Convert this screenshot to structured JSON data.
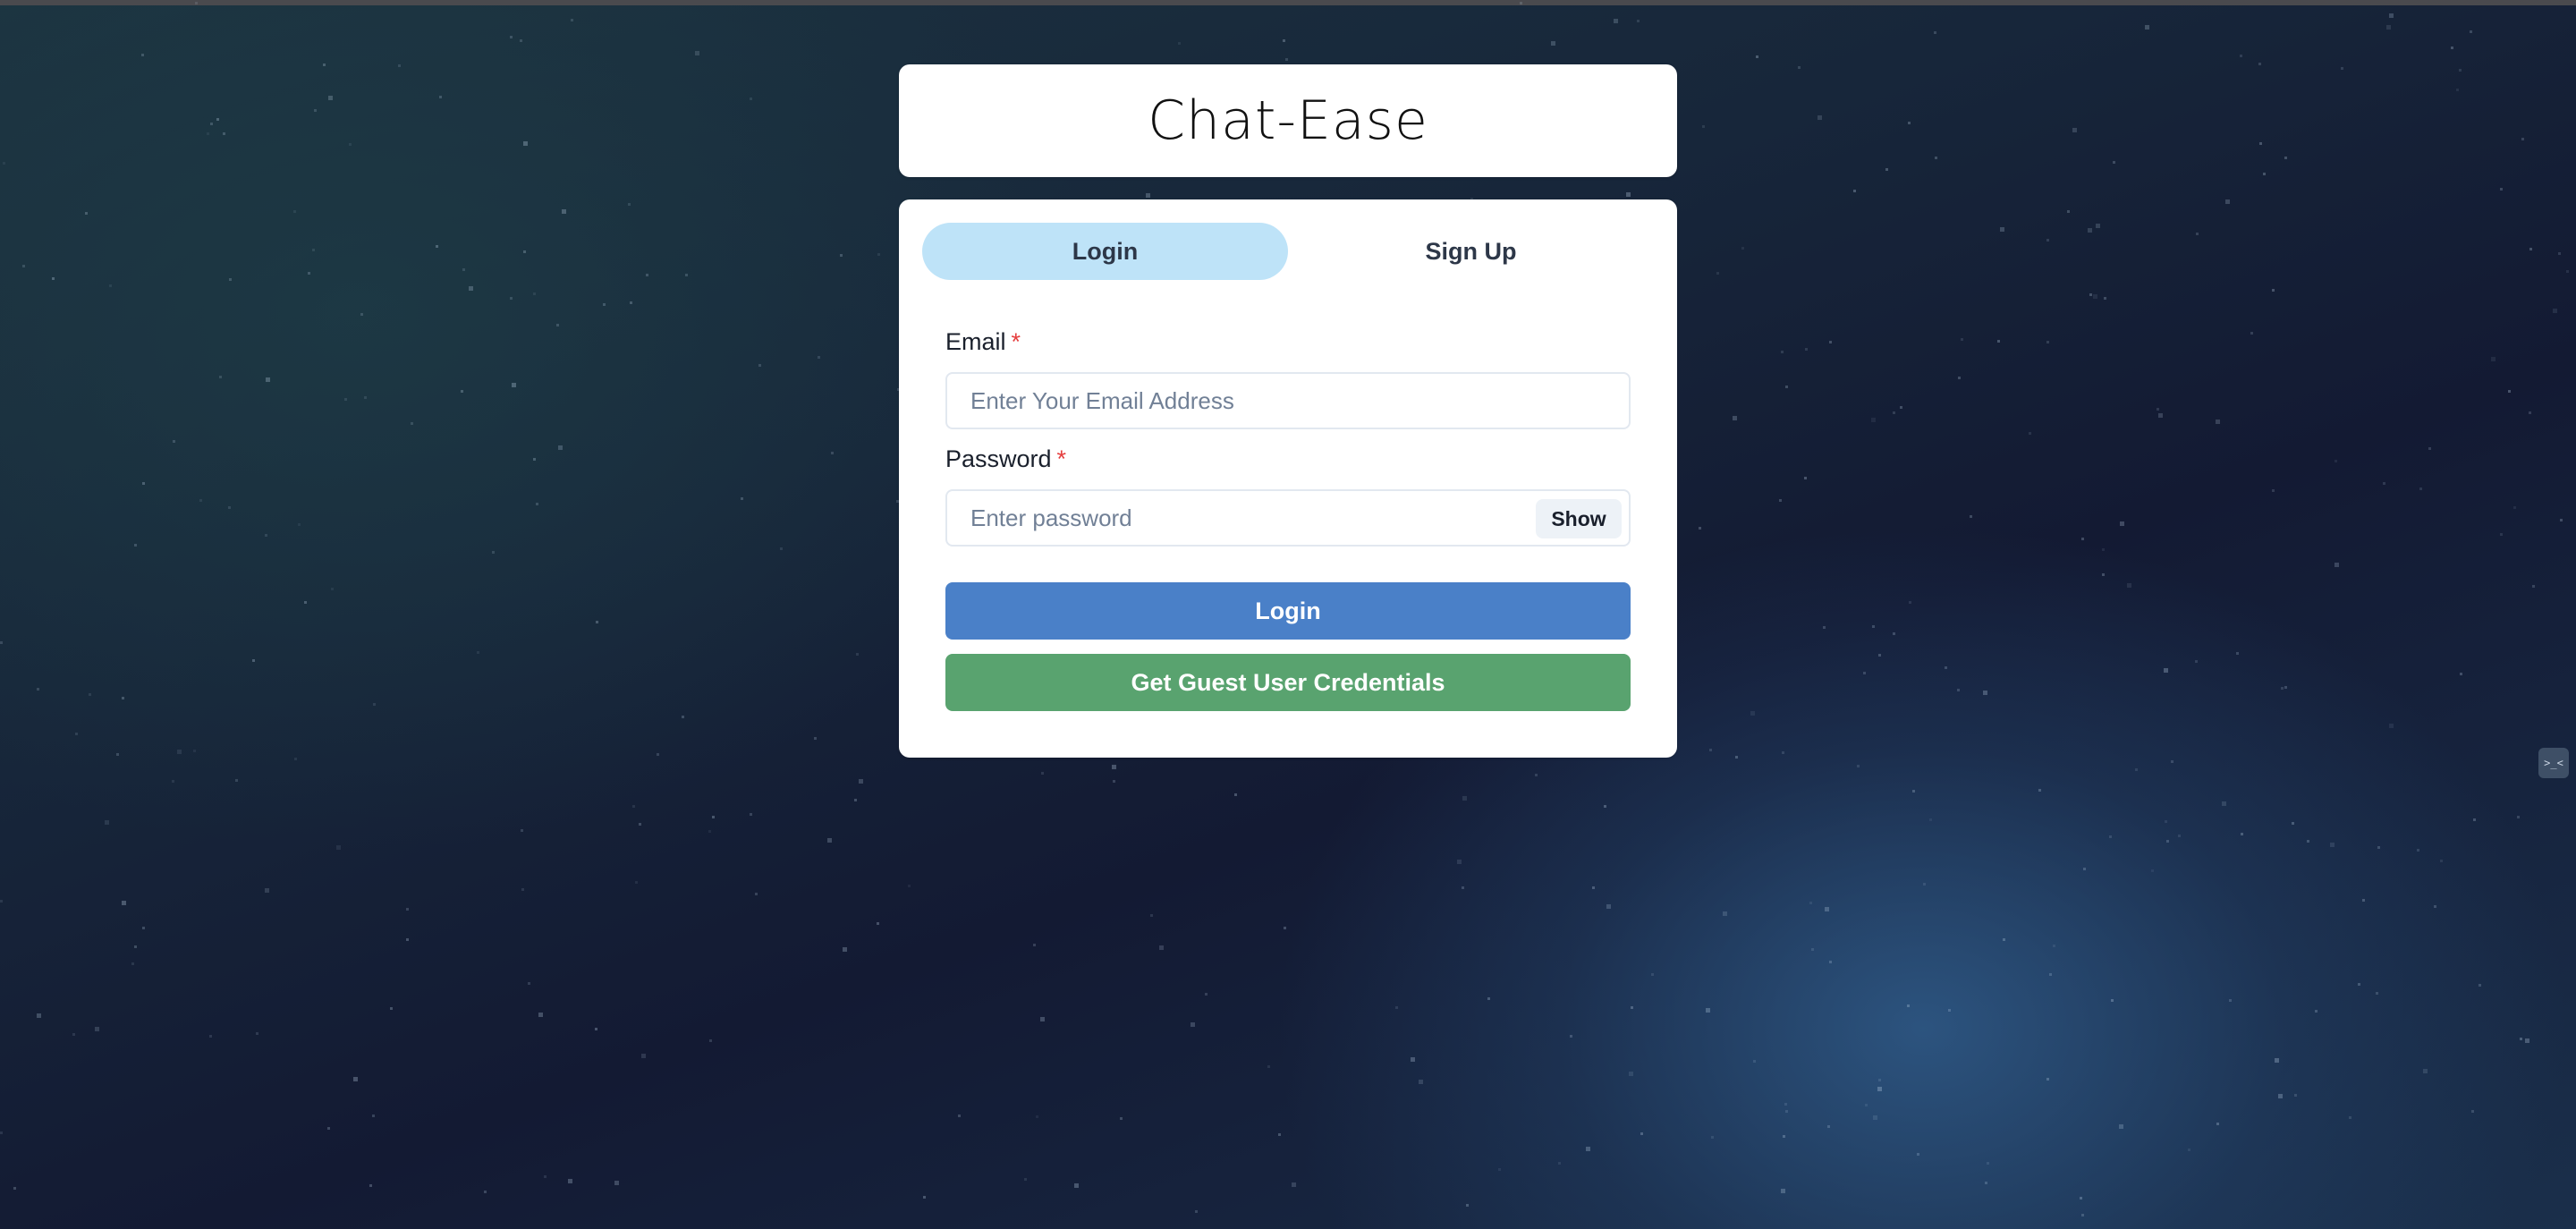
{
  "app": {
    "title": "Chat-Ease"
  },
  "tabs": [
    {
      "label": "Login",
      "active": true
    },
    {
      "label": "Sign Up",
      "active": false
    }
  ],
  "form": {
    "email": {
      "label": "Email",
      "required_mark": "*",
      "placeholder": "Enter Your Email Address",
      "value": ""
    },
    "password": {
      "label": "Password",
      "required_mark": "*",
      "placeholder": "Enter password",
      "value": "",
      "toggle_label": "Show"
    },
    "login_button": "Login",
    "guest_button": "Get Guest User Credentials"
  },
  "edge_widget": {
    "icon": "extension-icon",
    "glyph": ">_<"
  },
  "colors": {
    "active_tab": "#bee3f8",
    "login_button": "#4a80c8",
    "guest_button": "#59a36f",
    "required": "#e53e3e"
  }
}
